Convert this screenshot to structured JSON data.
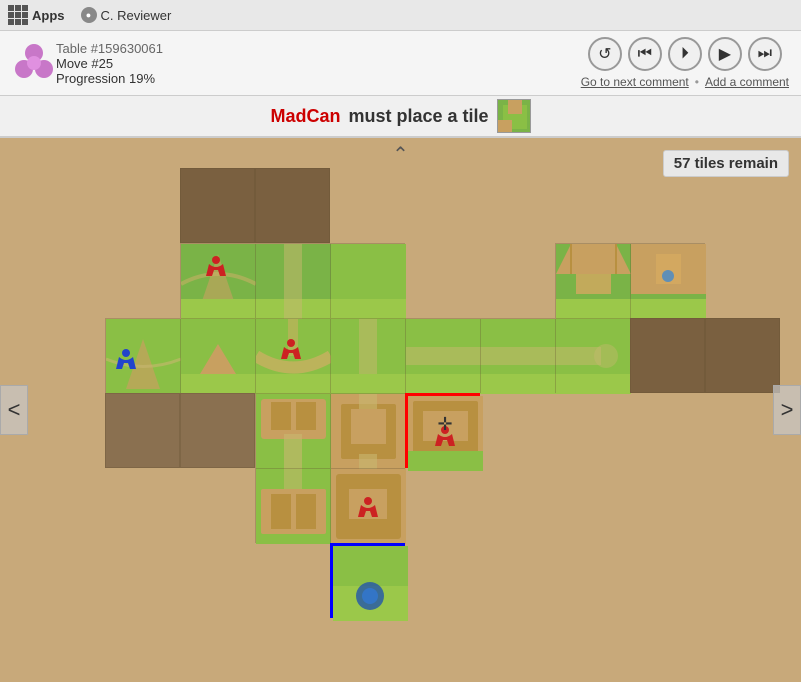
{
  "topbar": {
    "apps_label": "Apps",
    "reviewer_label": "C. Reviewer"
  },
  "infobar": {
    "table_id": "Table #159630061",
    "move": "Move #25",
    "progression": "Progression 19%",
    "controls": {
      "rewind_label": "⟳",
      "skip_back_label": "⏮",
      "play_label": "⏵",
      "play_alt_label": "▶",
      "skip_fwd_label": "⏭"
    },
    "go_next_comment": "Go to next comment",
    "separator": "•",
    "add_comment": "Add a comment"
  },
  "statusbar": {
    "player_name": "MadCan",
    "action": "must place a tile"
  },
  "gamearea": {
    "tiles_remain": "57 tiles remain",
    "chevron_up": "^",
    "nav_left": "<",
    "nav_right": ">"
  }
}
